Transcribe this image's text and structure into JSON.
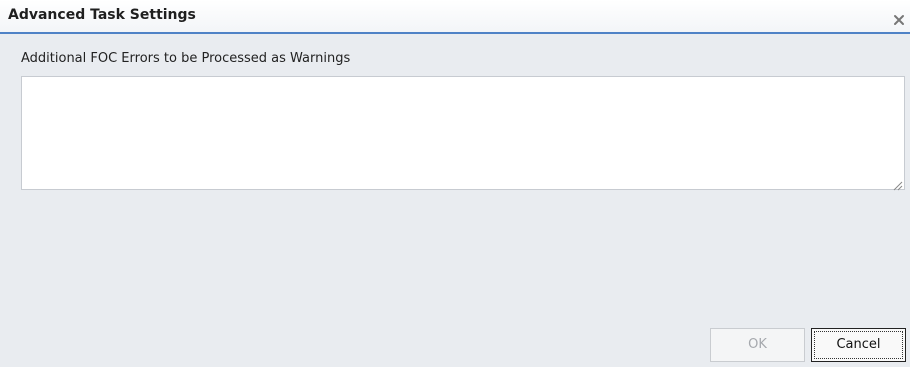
{
  "dialog": {
    "title": "Advanced Task Settings",
    "close_icon": "close-icon",
    "close_glyph": "x"
  },
  "form": {
    "field_label": "Additional FOC Errors to be Processed as Warnings",
    "field_value": ""
  },
  "buttons": {
    "ok_label": "OK",
    "ok_enabled": false,
    "cancel_label": "Cancel"
  },
  "colors": {
    "title_border": "#4f82c6",
    "dialog_background": "#e9ecf0",
    "disabled_text": "#a5a8ad"
  }
}
